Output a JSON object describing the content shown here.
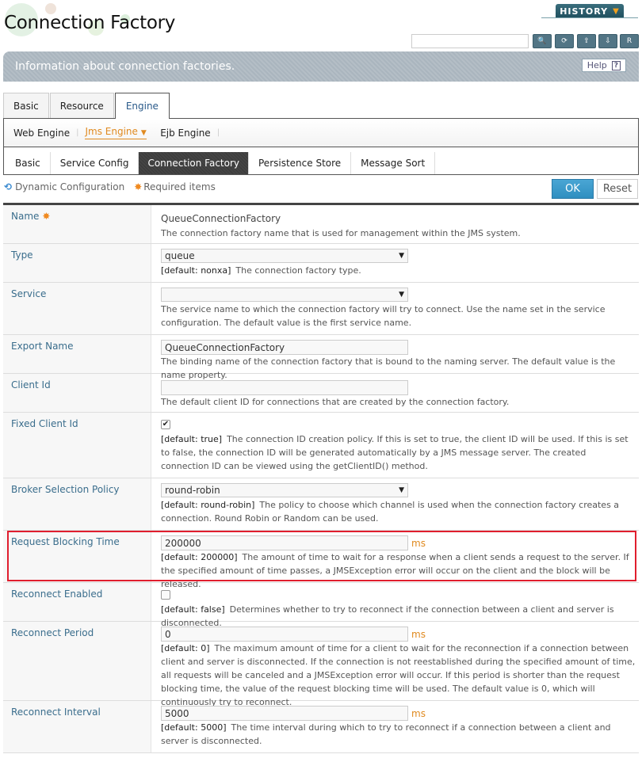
{
  "header": {
    "title": "Connection Factory",
    "history_label": "HISTORY",
    "search_placeholder": "",
    "tools": [
      {
        "name": "search-icon",
        "glyph": "🔍"
      },
      {
        "name": "refresh-icon",
        "glyph": "⟳"
      },
      {
        "name": "xml-export-icon",
        "glyph": "XML↑"
      },
      {
        "name": "xml-import-icon",
        "glyph": "XML↓"
      },
      {
        "name": "report-icon",
        "glyph": "R"
      }
    ]
  },
  "info": {
    "text": "Information about connection factories.",
    "help_label": "Help",
    "help_glyph": "?"
  },
  "tabs": [
    {
      "label": "Basic",
      "active": false
    },
    {
      "label": "Resource",
      "active": false
    },
    {
      "label": "Engine",
      "active": true
    }
  ],
  "subnav": [
    {
      "label": "Web Engine",
      "active": false
    },
    {
      "label": "Jms Engine",
      "active": true
    },
    {
      "label": "Ejb Engine",
      "active": false
    }
  ],
  "subtabs": [
    {
      "label": "Basic",
      "active": false
    },
    {
      "label": "Service Config",
      "active": false
    },
    {
      "label": "Connection Factory",
      "active": true
    },
    {
      "label": "Persistence Store",
      "active": false
    },
    {
      "label": "Message Sort",
      "active": false
    }
  ],
  "legend": {
    "dynamic": "Dynamic Configuration",
    "required": "Required items"
  },
  "buttons": {
    "ok": "OK",
    "reset": "Reset"
  },
  "fields": {
    "name": {
      "label": "Name",
      "value": "QueueConnectionFactory",
      "desc": "The connection factory name that is used for management within the JMS system."
    },
    "type": {
      "label": "Type",
      "value": "queue",
      "default": "[default: nonxa]",
      "desc": "The connection factory type."
    },
    "service": {
      "label": "Service",
      "value": "",
      "desc": "The service name to which the connection factory will try to connect. Use the name set in the service configuration. The default value is the first service name."
    },
    "export_name": {
      "label": "Export Name",
      "value": "QueueConnectionFactory",
      "desc": "The binding name of the connection factory that is bound to the naming server. The default value is the name property."
    },
    "client_id": {
      "label": "Client Id",
      "value": "",
      "desc": "The default client ID for connections that are created by the connection factory."
    },
    "fixed_client_id": {
      "label": "Fixed Client Id",
      "checked": true,
      "default": "[default: true]",
      "desc": "The connection ID creation policy. If this is set to true, the client ID will be used. If this is set to false, the connection ID will be generated automatically by a JMS message server. The created connection ID can be viewed using the getClientID() method."
    },
    "broker_selection_policy": {
      "label": "Broker Selection Policy",
      "value": "round-robin",
      "default": "[default: round-robin]",
      "desc": "The policy to choose which channel is used when the connection factory creates a connection. Round Robin or Random can be used."
    },
    "request_blocking_time": {
      "label": "Request Blocking Time",
      "value": "200000",
      "unit": "ms",
      "default": "[default: 200000]",
      "desc": "The amount of time to wait for a response when a client sends a request to the server. If the specified amount of time passes, a JMSException error will occur on the client and the block will be released."
    },
    "reconnect_enabled": {
      "label": "Reconnect Enabled",
      "checked": false,
      "default": "[default: false]",
      "desc": "Determines whether to try to reconnect if the connection between a client and server is disconnected."
    },
    "reconnect_period": {
      "label": "Reconnect Period",
      "value": "0",
      "unit": "ms",
      "default": "[default: 0]",
      "desc": "The maximum amount of time for a client to wait for the reconnection if a connection between client and server is disconnected. If the connection is not reestablished during the specified amount of time, all requests will be canceled and a JMSException error will occur. If this period is shorter than the request blocking time, the value of the request blocking time will be used. The default value is 0, which will continuously try to reconnect."
    },
    "reconnect_interval": {
      "label": "Reconnect Interval",
      "value": "5000",
      "unit": "ms",
      "default": "[default: 5000]",
      "desc": "The time interval during which to try to reconnect if a connection between a client and server is disconnected."
    }
  },
  "colors": {
    "accent": "#2f8fc0",
    "label": "#3a6d8c",
    "highlight": "#e01e2e",
    "unit": "#e08a20"
  }
}
